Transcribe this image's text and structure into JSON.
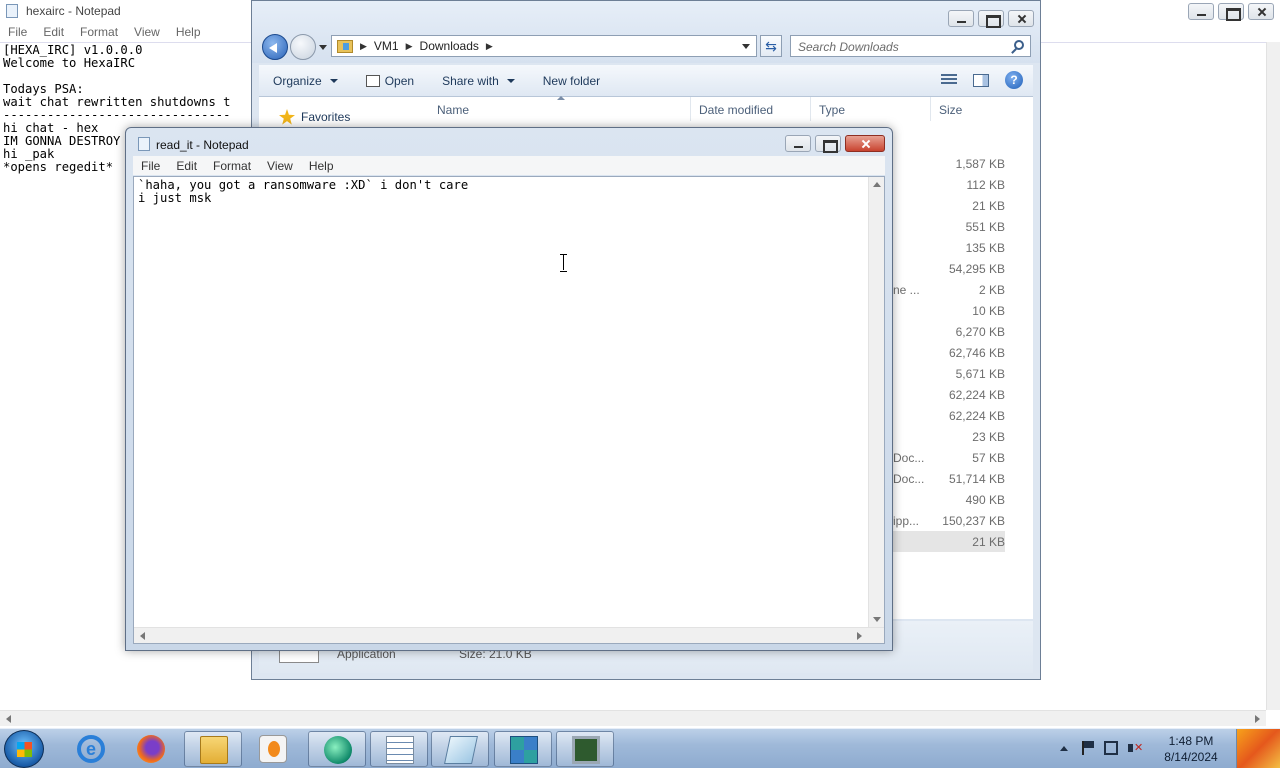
{
  "bg_notepad": {
    "title": "hexairc - Notepad",
    "menu": [
      "File",
      "Edit",
      "Format",
      "View",
      "Help"
    ],
    "content": "[HEXA_IRC] v1.0.0.0\nWelcome to HexaIRC\n\nTodays PSA:\nwait chat rewritten shutdowns t\n-------------------------------\nhi chat - hex\nIM GONNA DESTROY\nhi _pak\n*opens regedit*"
  },
  "explorer": {
    "breadcrumb": [
      "VM1",
      "Downloads"
    ],
    "search_placeholder": "Search Downloads",
    "commands": {
      "organize": "Organize",
      "open": "Open",
      "share_with": "Share with",
      "new_folder": "New folder"
    },
    "nav": {
      "favorites": "Favorites"
    },
    "columns": {
      "name": "Name",
      "date_modified": "Date modified",
      "type": "Type",
      "size": "Size"
    },
    "rows": [
      {
        "type_fragment": "",
        "size": "1,587 KB"
      },
      {
        "type_fragment": "",
        "size": "112 KB"
      },
      {
        "type_fragment": "",
        "size": "21 KB"
      },
      {
        "type_fragment": "",
        "size": "551 KB"
      },
      {
        "type_fragment": "",
        "size": "135 KB"
      },
      {
        "type_fragment": "",
        "size": "54,295 KB"
      },
      {
        "type_fragment": "ne ...",
        "size": "2 KB"
      },
      {
        "type_fragment": "",
        "size": "10 KB"
      },
      {
        "type_fragment": "",
        "size": "6,270 KB"
      },
      {
        "type_fragment": "",
        "size": "62,746 KB"
      },
      {
        "type_fragment": "",
        "size": "5,671 KB"
      },
      {
        "type_fragment": "",
        "size": "62,224 KB"
      },
      {
        "type_fragment": "",
        "size": "62,224 KB"
      },
      {
        "type_fragment": "",
        "size": "23 KB"
      },
      {
        "type_fragment": "Doc...",
        "size": "57 KB"
      },
      {
        "type_fragment": "Doc...",
        "size": "51,714 KB"
      },
      {
        "type_fragment": "",
        "size": "490 KB"
      },
      {
        "type_fragment": "ipp...",
        "size": "150,237 KB"
      },
      {
        "type_fragment": "",
        "size": "21 KB",
        "selected": true
      }
    ],
    "details": {
      "type": "Application",
      "size": "Size: 21.0 KB"
    }
  },
  "readit": {
    "title": "read_it - Notepad",
    "menu": [
      "File",
      "Edit",
      "Format",
      "View",
      "Help"
    ],
    "content": "`haha, you got a ransomware :XD` i don't care\ni just msk"
  },
  "taskbar": {
    "apps": [
      "internet-explorer",
      "firefox",
      "file-explorer",
      "media-player",
      "browser-globe",
      "notepad",
      "notepad-active",
      "registry-cubes",
      "task-monitor"
    ],
    "active_app": "notepad-active",
    "clock": {
      "time": "1:48 PM",
      "date": "8/14/2024"
    }
  }
}
